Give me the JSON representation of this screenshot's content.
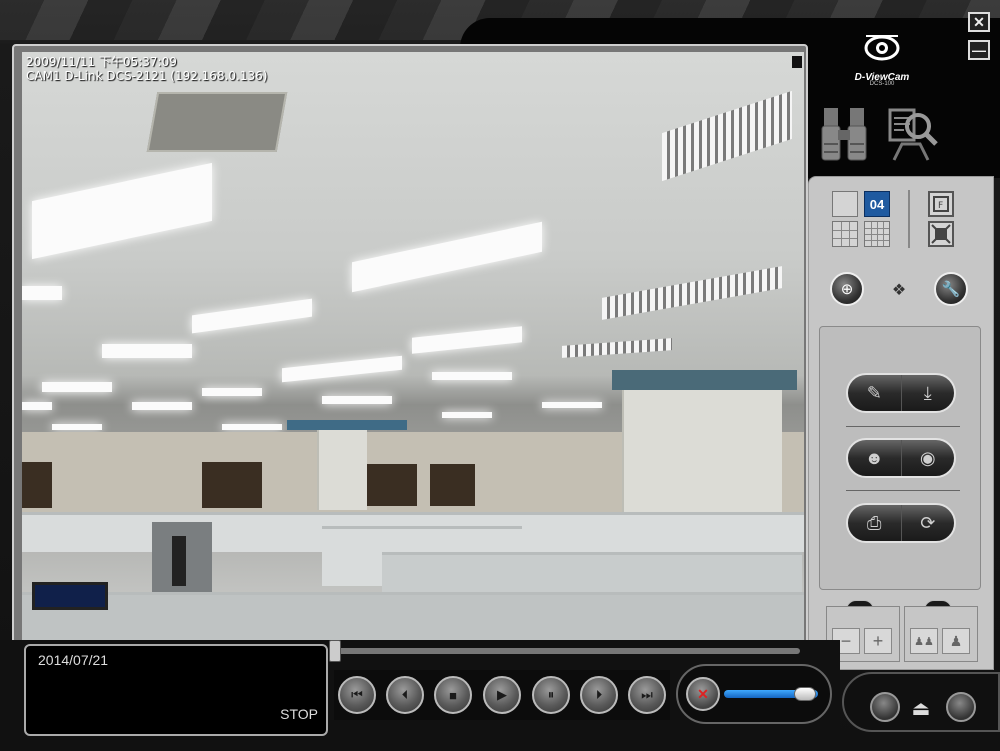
{
  "window": {
    "close_icon": "✕",
    "minimize_icon": "—"
  },
  "brand": {
    "name": "D-ViewCam",
    "model": "DCS-100"
  },
  "video": {
    "timestamp": "2009/11/11 下午05:37:09",
    "camera_label": "CAM1 D-Link DCS-2121 (192.168.0.136)"
  },
  "mode_icons": {
    "live": "binoculars-icon",
    "playback": "search-playback-icon"
  },
  "layout": {
    "active_label": "04",
    "buttons": [
      "single-view",
      "4-view",
      "9-view",
      "16-view"
    ]
  },
  "playback": {
    "date": "2014/07/21",
    "status": "STOP",
    "controls": [
      "first",
      "previous",
      "stop",
      "play",
      "pause",
      "next",
      "last"
    ],
    "control_glyphs": [
      "⏮",
      "⏴",
      "■",
      "▶",
      "⏸",
      "⏵",
      "⏭"
    ]
  },
  "volume": {
    "level": 0.75,
    "muted": true
  },
  "speed_panel": {
    "minus": "−",
    "plus": "+"
  },
  "colors": {
    "accent": "#1f5aa0",
    "volume": "#3fa9ff",
    "panel": "#c6c6c6"
  }
}
